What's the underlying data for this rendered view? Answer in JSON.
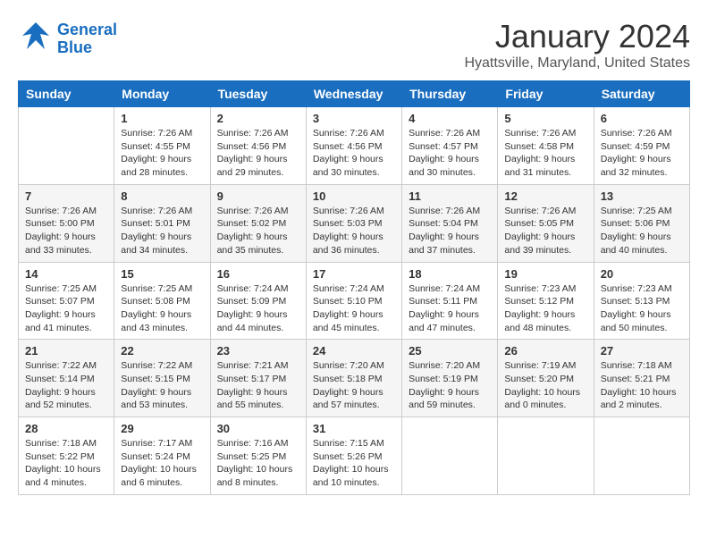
{
  "header": {
    "logo_line1": "General",
    "logo_line2": "Blue",
    "month": "January 2024",
    "location": "Hyattsville, Maryland, United States"
  },
  "weekdays": [
    "Sunday",
    "Monday",
    "Tuesday",
    "Wednesday",
    "Thursday",
    "Friday",
    "Saturday"
  ],
  "weeks": [
    [
      {
        "day": "",
        "info": ""
      },
      {
        "day": "1",
        "info": "Sunrise: 7:26 AM\nSunset: 4:55 PM\nDaylight: 9 hours\nand 28 minutes."
      },
      {
        "day": "2",
        "info": "Sunrise: 7:26 AM\nSunset: 4:56 PM\nDaylight: 9 hours\nand 29 minutes."
      },
      {
        "day": "3",
        "info": "Sunrise: 7:26 AM\nSunset: 4:56 PM\nDaylight: 9 hours\nand 30 minutes."
      },
      {
        "day": "4",
        "info": "Sunrise: 7:26 AM\nSunset: 4:57 PM\nDaylight: 9 hours\nand 30 minutes."
      },
      {
        "day": "5",
        "info": "Sunrise: 7:26 AM\nSunset: 4:58 PM\nDaylight: 9 hours\nand 31 minutes."
      },
      {
        "day": "6",
        "info": "Sunrise: 7:26 AM\nSunset: 4:59 PM\nDaylight: 9 hours\nand 32 minutes."
      }
    ],
    [
      {
        "day": "7",
        "info": "Sunrise: 7:26 AM\nSunset: 5:00 PM\nDaylight: 9 hours\nand 33 minutes."
      },
      {
        "day": "8",
        "info": "Sunrise: 7:26 AM\nSunset: 5:01 PM\nDaylight: 9 hours\nand 34 minutes."
      },
      {
        "day": "9",
        "info": "Sunrise: 7:26 AM\nSunset: 5:02 PM\nDaylight: 9 hours\nand 35 minutes."
      },
      {
        "day": "10",
        "info": "Sunrise: 7:26 AM\nSunset: 5:03 PM\nDaylight: 9 hours\nand 36 minutes."
      },
      {
        "day": "11",
        "info": "Sunrise: 7:26 AM\nSunset: 5:04 PM\nDaylight: 9 hours\nand 37 minutes."
      },
      {
        "day": "12",
        "info": "Sunrise: 7:26 AM\nSunset: 5:05 PM\nDaylight: 9 hours\nand 39 minutes."
      },
      {
        "day": "13",
        "info": "Sunrise: 7:25 AM\nSunset: 5:06 PM\nDaylight: 9 hours\nand 40 minutes."
      }
    ],
    [
      {
        "day": "14",
        "info": "Sunrise: 7:25 AM\nSunset: 5:07 PM\nDaylight: 9 hours\nand 41 minutes."
      },
      {
        "day": "15",
        "info": "Sunrise: 7:25 AM\nSunset: 5:08 PM\nDaylight: 9 hours\nand 43 minutes."
      },
      {
        "day": "16",
        "info": "Sunrise: 7:24 AM\nSunset: 5:09 PM\nDaylight: 9 hours\nand 44 minutes."
      },
      {
        "day": "17",
        "info": "Sunrise: 7:24 AM\nSunset: 5:10 PM\nDaylight: 9 hours\nand 45 minutes."
      },
      {
        "day": "18",
        "info": "Sunrise: 7:24 AM\nSunset: 5:11 PM\nDaylight: 9 hours\nand 47 minutes."
      },
      {
        "day": "19",
        "info": "Sunrise: 7:23 AM\nSunset: 5:12 PM\nDaylight: 9 hours\nand 48 minutes."
      },
      {
        "day": "20",
        "info": "Sunrise: 7:23 AM\nSunset: 5:13 PM\nDaylight: 9 hours\nand 50 minutes."
      }
    ],
    [
      {
        "day": "21",
        "info": "Sunrise: 7:22 AM\nSunset: 5:14 PM\nDaylight: 9 hours\nand 52 minutes."
      },
      {
        "day": "22",
        "info": "Sunrise: 7:22 AM\nSunset: 5:15 PM\nDaylight: 9 hours\nand 53 minutes."
      },
      {
        "day": "23",
        "info": "Sunrise: 7:21 AM\nSunset: 5:17 PM\nDaylight: 9 hours\nand 55 minutes."
      },
      {
        "day": "24",
        "info": "Sunrise: 7:20 AM\nSunset: 5:18 PM\nDaylight: 9 hours\nand 57 minutes."
      },
      {
        "day": "25",
        "info": "Sunrise: 7:20 AM\nSunset: 5:19 PM\nDaylight: 9 hours\nand 59 minutes."
      },
      {
        "day": "26",
        "info": "Sunrise: 7:19 AM\nSunset: 5:20 PM\nDaylight: 10 hours\nand 0 minutes."
      },
      {
        "day": "27",
        "info": "Sunrise: 7:18 AM\nSunset: 5:21 PM\nDaylight: 10 hours\nand 2 minutes."
      }
    ],
    [
      {
        "day": "28",
        "info": "Sunrise: 7:18 AM\nSunset: 5:22 PM\nDaylight: 10 hours\nand 4 minutes."
      },
      {
        "day": "29",
        "info": "Sunrise: 7:17 AM\nSunset: 5:24 PM\nDaylight: 10 hours\nand 6 minutes."
      },
      {
        "day": "30",
        "info": "Sunrise: 7:16 AM\nSunset: 5:25 PM\nDaylight: 10 hours\nand 8 minutes."
      },
      {
        "day": "31",
        "info": "Sunrise: 7:15 AM\nSunset: 5:26 PM\nDaylight: 10 hours\nand 10 minutes."
      },
      {
        "day": "",
        "info": ""
      },
      {
        "day": "",
        "info": ""
      },
      {
        "day": "",
        "info": ""
      }
    ]
  ]
}
